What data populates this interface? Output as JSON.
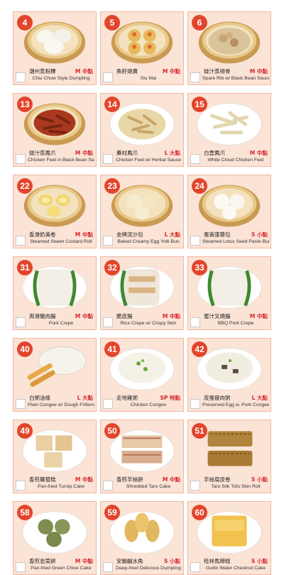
{
  "items": [
    {
      "number": "4",
      "zh": "潮州蒸粉粿",
      "size": "M 中點",
      "en": "Chiu Chow Style Dumpling",
      "food": "dumpling-white"
    },
    {
      "number": "5",
      "zh": "魚籽燒賣",
      "size": "M 中點",
      "en": "Siu Mai",
      "food": "siumai"
    },
    {
      "number": "6",
      "zh": "豉汁蒸排骨",
      "size": "M 中點",
      "en": "Spare Rib w/ Black Bean Sauce",
      "food": "spareribs"
    },
    {
      "number": "13",
      "zh": "豉汁蒸鳳爪",
      "size": "M 中點",
      "en": "Chicken Feet in Black Bean Sauce",
      "food": "chickenfeet-red"
    },
    {
      "number": "14",
      "zh": "藥材鳳爪",
      "size": "L 大點",
      "en": "Chicken Feet w/ Herbal Sauce",
      "food": "chickenfeet-herbal"
    },
    {
      "number": "15",
      "zh": "白雲鳳爪",
      "size": "M 中點",
      "en": "White Cloud Chicken Feet",
      "food": "chickenfeet-white"
    },
    {
      "number": "22",
      "zh": "香滑奶黃卷",
      "size": "M 中點",
      "en": "Steamed Sweet Custard Roll",
      "food": "custardroll"
    },
    {
      "number": "23",
      "zh": "金牌流沙包",
      "size": "L 大點",
      "en": "Baked Creamy Egg Yolk Bun",
      "food": "bun-yellow"
    },
    {
      "number": "24",
      "zh": "蛋黃蓮蓉包",
      "size": "S 小點",
      "en": "Steamed Lotus Seed Paste Bun",
      "food": "bun-white"
    },
    {
      "number": "31",
      "zh": "爽滑豬肉腸",
      "size": "M 中點",
      "en": "Pork Crepe",
      "food": "crepe"
    },
    {
      "number": "32",
      "zh": "脆皮腸",
      "size": "M 中點",
      "en": "Rice Crepe w/ Crispy Skin",
      "food": "crepe-crispy"
    },
    {
      "number": "33",
      "zh": "蜜汁叉燒腸",
      "size": "M 中點",
      "en": "BBQ Pork Crepe",
      "food": "crepe"
    },
    {
      "number": "40",
      "zh": "白粥油條",
      "size": "L 大點",
      "en": "Plain Congee w/ Dough Fritters",
      "food": "congee-plain"
    },
    {
      "number": "41",
      "zh": "走地雞粥",
      "size": "SP 特點",
      "en": "Chicken Congee",
      "food": "congee-chicken"
    },
    {
      "number": "42",
      "zh": "皮蛋瘦肉粥",
      "size": "L 大點",
      "en": "Preserved Egg w. Pork Congee",
      "food": "congee-pork"
    },
    {
      "number": "49",
      "zh": "香煎蘿蔔糕",
      "size": "M 中點",
      "en": "Pan-fried Turnip Cake",
      "food": "turnipcake"
    },
    {
      "number": "50",
      "zh": "香煎芋絲餅",
      "size": "M 中點",
      "en": "Shredded Taro Cake",
      "food": "tarocake"
    },
    {
      "number": "51",
      "zh": "芋絲腐皮卷",
      "size": "S 小點",
      "en": "Taro Silk Tofu Skin Roll",
      "food": "tofuroll"
    },
    {
      "number": "58",
      "zh": "香煎韭菜餅",
      "size": "M 中點",
      "en": "Pan-fried Green Chive Cake",
      "food": "chivecake"
    },
    {
      "number": "59",
      "zh": "安蝦鹹水角",
      "size": "S 小點",
      "en": "Deep-fried Delicious Dumpling",
      "food": "friedumpling"
    },
    {
      "number": "60",
      "zh": "桂林馬蹄糕",
      "size": "S 小點",
      "en": "Guilin Water Chestnut Cake",
      "food": "chestnutcake"
    }
  ]
}
